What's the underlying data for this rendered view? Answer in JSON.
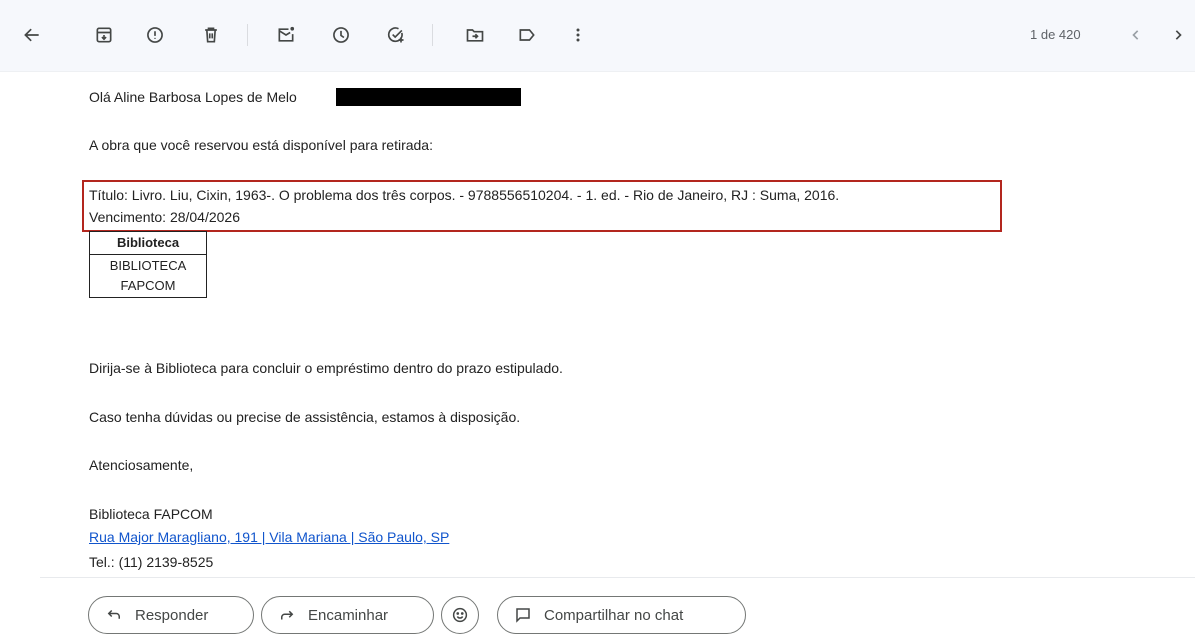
{
  "toolbar": {
    "icons": [
      "back-arrow-icon",
      "archive-icon",
      "report-spam-icon",
      "delete-icon",
      "mark-unread-icon",
      "snooze-icon",
      "add-task-icon",
      "move-to-icon",
      "label-icon",
      "more-vert-icon"
    ],
    "pager": "1 de 420"
  },
  "email": {
    "greeting": "Olá Aline Barbosa Lopes de Melo",
    "intro": "A obra que você reservou está disponível para retirada:",
    "title_line": "Título: Livro. Liu, Cixin, 1963-. O problema dos três corpos. - 9788556510204. - 1. ed. - Rio de Janeiro, RJ : Suma, 2016.",
    "due_line": "Vencimento: 28/04/2026",
    "table": {
      "header": "Biblioteca",
      "cell_line1": "BIBLIOTECA",
      "cell_line2": "FAPCOM"
    },
    "instruction": "Dirija-se à Biblioteca para concluir o empréstimo dentro do prazo estipulado.",
    "help": "Caso tenha dúvidas ou precise de assistência, estamos à disposição.",
    "closing": "Atenciosamente,",
    "signature_name": "Biblioteca FAPCOM",
    "signature_address": "Rua Major Maragliano, 191 | Vila Mariana | São Paulo, SP",
    "signature_phone": "Tel.: (11) 2139-8525"
  },
  "actions": {
    "reply": "Responder",
    "forward": "Encaminhar",
    "share_chat": "Compartilhar no chat"
  },
  "colors": {
    "highlight_border": "#b3261e",
    "link": "#1155cc",
    "toolbar_bg": "#f6f8fc"
  }
}
